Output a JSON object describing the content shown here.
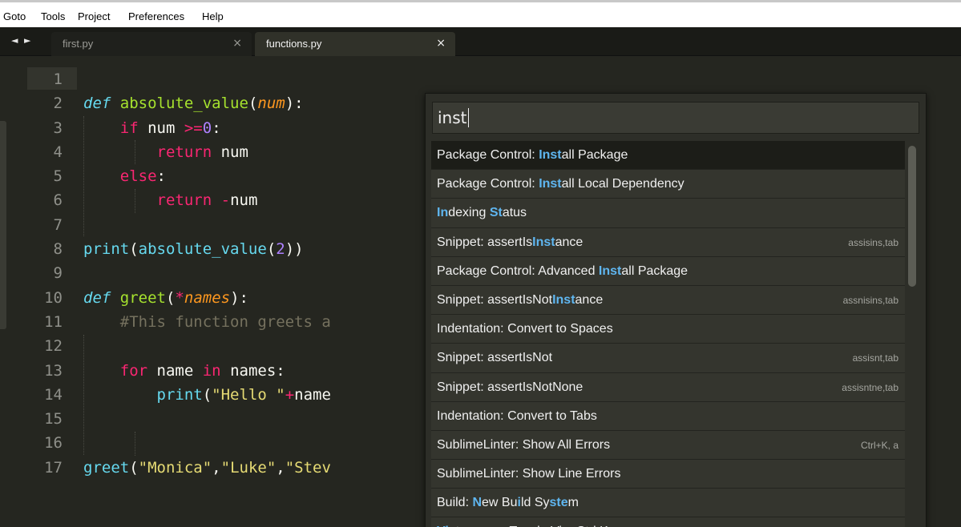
{
  "menubar": {
    "items": [
      "Goto",
      "Tools",
      "Project",
      "Preferences",
      "Help"
    ]
  },
  "tabs": {
    "arrows": "◄ ►",
    "items": [
      {
        "label": "first.py",
        "close": "×"
      },
      {
        "label": "functions.py",
        "close": "×"
      }
    ]
  },
  "editor": {
    "line_numbers": [
      "1",
      "2",
      "3",
      "4",
      "5",
      "6",
      "7",
      "8",
      "9",
      "10",
      "11",
      "12",
      "13",
      "14",
      "15",
      "16",
      "17"
    ]
  },
  "palette": {
    "query": "inst",
    "items": [
      {
        "label": "Package Control: Install Package",
        "shortcut": ""
      },
      {
        "label": "Package Control: Install Local Dependency",
        "shortcut": ""
      },
      {
        "label": "Indexing Status",
        "shortcut": ""
      },
      {
        "label": "Snippet: assertIsInstance",
        "shortcut": "assisins,tab"
      },
      {
        "label": "Package Control: Advanced Install Package",
        "shortcut": ""
      },
      {
        "label": "Snippet: assertIsNotInstance",
        "shortcut": "assnisins,tab"
      },
      {
        "label": "Indentation: Convert to Spaces",
        "shortcut": ""
      },
      {
        "label": "Snippet: assertIsNot",
        "shortcut": "assisnt,tab"
      },
      {
        "label": "Snippet: assertIsNotNone",
        "shortcut": "assisntne,tab"
      },
      {
        "label": "Indentation: Convert to Tabs",
        "shortcut": ""
      },
      {
        "label": "SublimeLinter: Show All Errors",
        "shortcut": "Ctrl+K, a"
      },
      {
        "label": "SublimeLinter: Show Line Errors",
        "shortcut": ""
      },
      {
        "label": "Build: New Build System",
        "shortcut": ""
      },
      {
        "label": "Vintageous: Toggle Vim Ctrl Keys",
        "shortcut": ""
      }
    ]
  },
  "colors": {
    "editor_bg": "#252620",
    "keyword": "#f92672",
    "function": "#a6e22e",
    "string": "#e6db74",
    "number": "#ae81ff",
    "match_highlight": "#5fb6f0"
  }
}
